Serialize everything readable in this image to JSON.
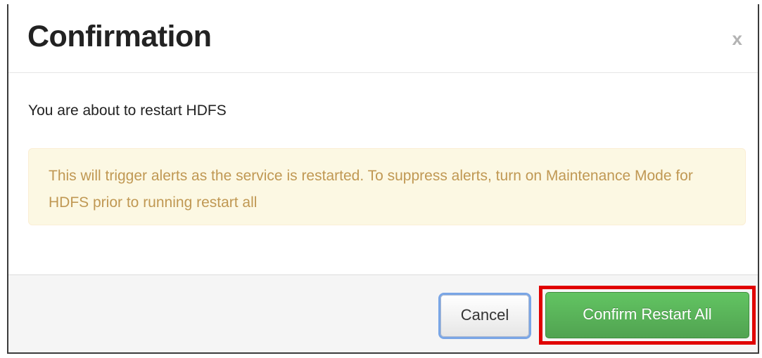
{
  "dialog": {
    "title": "Confirmation",
    "close_label": "x",
    "message": "You are about to restart HDFS",
    "alert": "This will trigger alerts as the service is restarted. To suppress alerts, turn on Maintenance Mode for HDFS prior to running restart all"
  },
  "footer": {
    "cancel_label": "Cancel",
    "confirm_label": "Confirm Restart All"
  },
  "colors": {
    "alert_background": "#fcf8e3",
    "alert_text": "#c09853",
    "confirm_button": "#51a351",
    "highlight": "#e00000"
  }
}
